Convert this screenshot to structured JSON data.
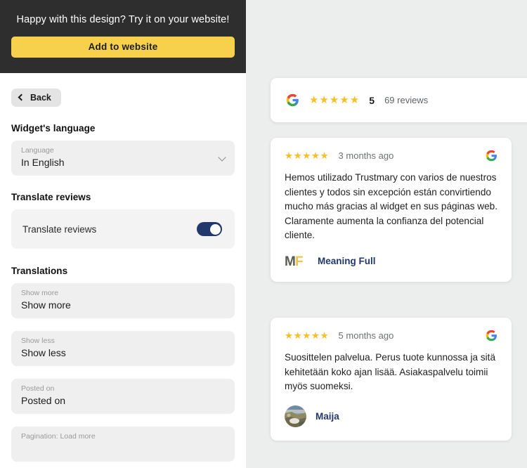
{
  "sidebar": {
    "promo": {
      "text": "Happy with this design? Try it on your website!",
      "button_label": "Add to website"
    },
    "back_label": "Back",
    "sections": {
      "widget_language_title": "Widget's language",
      "translate_reviews_title": "Translate reviews",
      "translations_title": "Translations"
    },
    "language_field": {
      "label": "Language",
      "value": "In English"
    },
    "translate_toggle": {
      "label": "Translate reviews",
      "enabled": true,
      "accent_color": "#20386b"
    },
    "translation_fields": [
      {
        "label": "Show more",
        "value": "Show more"
      },
      {
        "label": "Show less",
        "value": "Show less"
      },
      {
        "label": "Posted on",
        "value": "Posted on"
      },
      {
        "label": "Pagination: Load more",
        "value": ""
      }
    ]
  },
  "preview": {
    "summary": {
      "source_icon": "google-g-icon",
      "stars": 5,
      "rating": "5",
      "review_count_label": "69 reviews"
    },
    "reviews": [
      {
        "stars": 5,
        "date": "3 months ago",
        "source_icon": "google-g-icon",
        "text": "Hemos utilizado Trustmary con varios de nuestros clientes y todos sin excepción están convirtiendo mucho más gracias al widget en sus páginas web. Claramente aumenta la confianza del potencial cliente.",
        "author_name": "Meaning Full",
        "avatar_type": "mf-logo"
      },
      {
        "stars": 5,
        "date": "5 months ago",
        "source_icon": "google-g-icon",
        "text": "Suosittelen palvelua. Perus tuote kunnossa ja sitä kehitetään koko ajan lisää. Asiakaspalvelu toimii myös suomeksi.",
        "author_name": "Maija",
        "avatar_type": "photo"
      }
    ]
  },
  "colors": {
    "promo_bg": "#2e2e2e",
    "promo_button": "#f8d14c",
    "star": "#f7bf2a",
    "author": "#22386c",
    "panel_bg": "#eceded"
  }
}
